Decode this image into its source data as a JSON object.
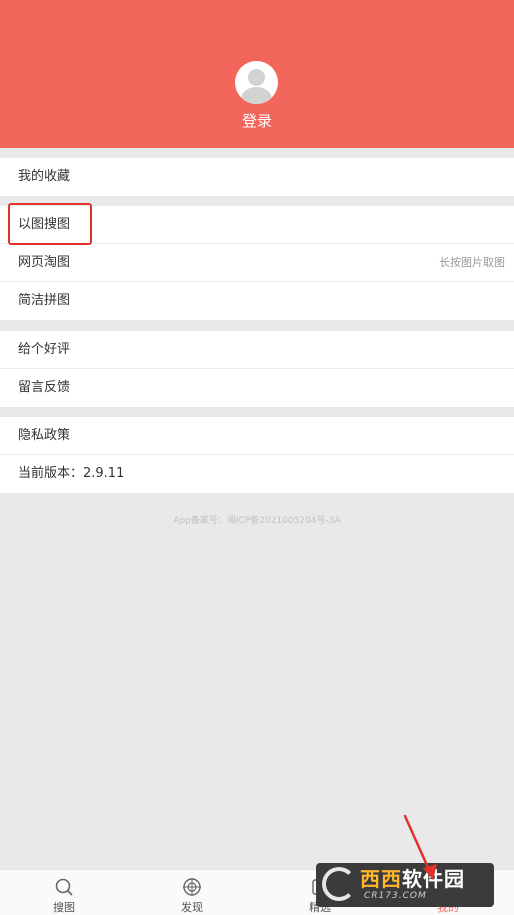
{
  "header": {
    "login_label": "登录",
    "background_color": "#f2665b"
  },
  "groups": [
    {
      "items": [
        {
          "label": "我的收藏"
        }
      ]
    },
    {
      "items": [
        {
          "label": "以图搜图"
        },
        {
          "label": "网页淘图",
          "hint": "长按图片取图"
        },
        {
          "label": "简洁拼图"
        }
      ]
    },
    {
      "items": [
        {
          "label": "给个好评"
        },
        {
          "label": "留言反馈"
        }
      ]
    },
    {
      "items": [
        {
          "label": "隐私政策"
        },
        {
          "label": "当前版本：2.9.11"
        }
      ]
    }
  ],
  "icp_text": "App备案号：湘ICP备2021005204号-3A",
  "tabbar": {
    "tabs": [
      {
        "label": "搜图",
        "icon": "search-icon"
      },
      {
        "label": "发现",
        "icon": "compass-icon"
      },
      {
        "label": "精选",
        "icon": "featured-icon"
      },
      {
        "label": "我的",
        "icon": "user-icon",
        "active": true
      }
    ],
    "active_color": "#f2665b"
  },
  "watermark": {
    "main_1": "西西",
    "main_2": "软件园",
    "sub": "CR173.COM"
  },
  "annotation_color": "#e0332b"
}
